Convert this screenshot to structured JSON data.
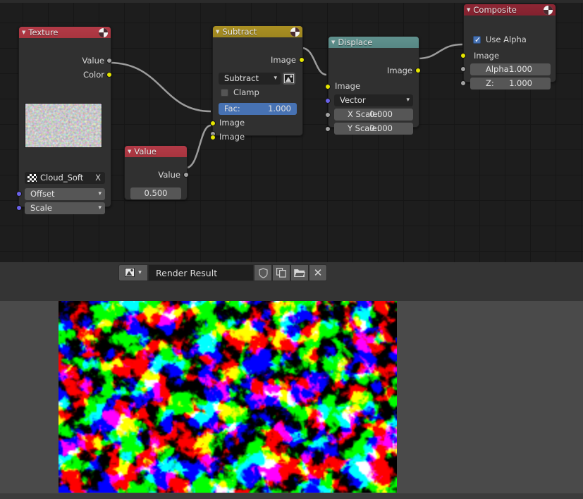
{
  "app": "blender-compositor",
  "node_editor": {
    "grid_size": 36,
    "background": "#1d1d1d",
    "nodes": [
      {
        "id": "texture",
        "title": "Texture",
        "header_color": "#b33a47",
        "icon": "node-texture-icon",
        "outputs": [
          {
            "label": "Value",
            "socket": "grey"
          },
          {
            "label": "Color",
            "socket": "yellow"
          }
        ],
        "datablock": {
          "name": "Cloud_Soft",
          "icon": "checker-texture-icon",
          "clear": "X"
        },
        "dropdowns": [
          {
            "label": "Offset",
            "socket": "purple"
          },
          {
            "label": "Scale",
            "socket": "purple"
          }
        ]
      },
      {
        "id": "value",
        "title": "Value",
        "header_color": "#b33a47",
        "outputs": [
          {
            "label": "Value",
            "socket": "grey"
          }
        ],
        "value_field": "0.500"
      },
      {
        "id": "subtract",
        "title": "Subtract",
        "header_color": "#ab9022",
        "icon": "node-texture-icon",
        "outputs": [
          {
            "label": "Image",
            "socket": "yellow"
          }
        ],
        "operation": "Subtract",
        "operation_icon": "image-icon",
        "clamp_label": "Clamp",
        "clamp_checked": false,
        "fac": {
          "label": "Fac:",
          "value": "1.000",
          "socket": "grey",
          "highlight": "#4772b3"
        },
        "inputs": [
          {
            "label": "Image",
            "socket": "yellow"
          },
          {
            "label": "Image",
            "socket": "yellow"
          }
        ]
      },
      {
        "id": "displace",
        "title": "Displace",
        "header_color": "#60918e",
        "outputs": [
          {
            "label": "Image",
            "socket": "yellow"
          }
        ],
        "inputs": [
          {
            "label": "Image",
            "socket": "yellow",
            "type": "label"
          },
          {
            "label": "Vector",
            "socket": "purple",
            "type": "dropdown"
          },
          {
            "label": "X Scale:",
            "value": "0.000",
            "socket": "grey",
            "type": "field"
          },
          {
            "label": "Y Scale:",
            "value": "0.000",
            "socket": "grey",
            "type": "field"
          }
        ]
      },
      {
        "id": "composite",
        "title": "Composite",
        "header_color": "#8e2634",
        "icon": "node-texture-icon",
        "use_alpha": {
          "label": "Use Alpha",
          "checked": true
        },
        "inputs": [
          {
            "label": "Image",
            "socket": "yellow",
            "type": "label"
          },
          {
            "label": "Alpha:",
            "value": "1.000",
            "socket": "grey",
            "type": "field"
          },
          {
            "label": "Z:",
            "value": "1.000",
            "socket": "grey",
            "type": "field"
          }
        ]
      }
    ],
    "links": [
      {
        "from": "texture.Color",
        "to": "subtract.Image1"
      },
      {
        "from": "value.Value",
        "to": "subtract.Image2"
      },
      {
        "from": "subtract.Image",
        "to": "displace.Image"
      },
      {
        "from": "displace.Image",
        "to": "composite.Image"
      }
    ]
  },
  "image_editor": {
    "browse_icon": "image-browse-icon",
    "browse_chevron": "chevron-down-icon",
    "image_name": "Render Result",
    "buttons": [
      {
        "name": "fake-user-button",
        "icon": "shield-icon"
      },
      {
        "name": "new-image-button",
        "icon": "copy-icon"
      },
      {
        "name": "open-image-button",
        "icon": "folder-icon"
      },
      {
        "name": "unlink-image-button",
        "icon": "close-icon",
        "glyph": "✕"
      }
    ]
  }
}
